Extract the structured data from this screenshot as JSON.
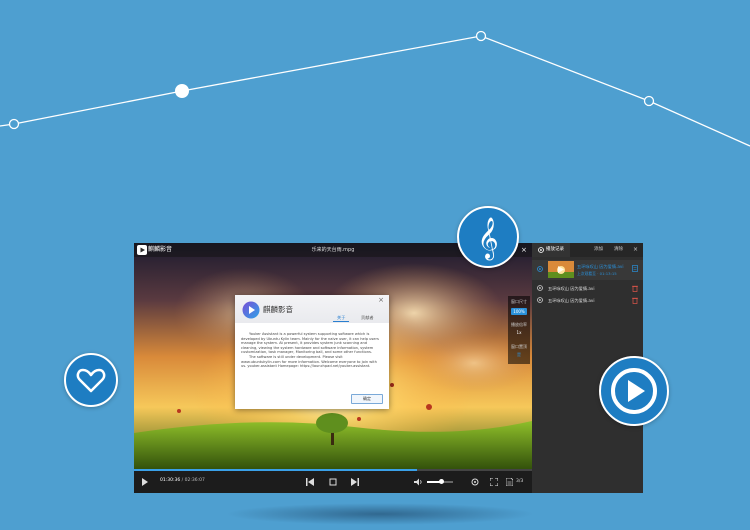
{
  "colors": {
    "background": "#4e9fd0",
    "accent": "#2a90d9",
    "bubble": "#1e7dc2"
  },
  "player": {
    "app_name": "麒麟影音",
    "file_title": "乐来的天台雨.mpg",
    "close_label": "×",
    "side_panel": {
      "window_size_label": "窗口尺寸",
      "window_size_value": "100%",
      "speed_label": "播放倍率",
      "speed_value": "1x",
      "pin_label": "窗口置顶",
      "pin_value": "是"
    },
    "controls": {
      "current_time": "01:30:36",
      "separator": " / ",
      "total_time": "02:36:07",
      "play_progress": 0.71,
      "volume_level": 0.55,
      "playlist_count": "3/3"
    }
  },
  "playlist": {
    "tabs": [
      "播放记录",
      "添加",
      "清除"
    ],
    "close_label": "×",
    "items": [
      {
        "title": "五环咏叹山 因为爱情.avi",
        "sub": "上次观看至 · 01:13:15",
        "active": true
      },
      {
        "title": "五环咏叹山 因为爱情.avi",
        "active": false
      },
      {
        "title": "五环咏叹山 因为爱情.avi",
        "active": false
      }
    ]
  },
  "about_dialog": {
    "app_name": "麒麟影音",
    "tabs": [
      "关于",
      "贡献者"
    ],
    "close_label": "×",
    "body": [
      "Youker Assistant is a powerful system supporting software which is developed by Ubuntu Kylin team. Mainly for the naive user, it can help users manage the system. At present, it provides system junk scanning and cleaning, viewing the system hardware and software information, system customization, task manager, Monitoring ball, and some other functions.",
      "The software is still under development. Please visit www.ubuntukylin.com for more information. Welcome everyone to join with us. youker-assistant Homepage: https://launchpad.net/youker-assistant."
    ],
    "ok_label": "确定"
  },
  "icons": [
    "treble-clef-icon",
    "heart-icon",
    "play-circle-icon"
  ]
}
